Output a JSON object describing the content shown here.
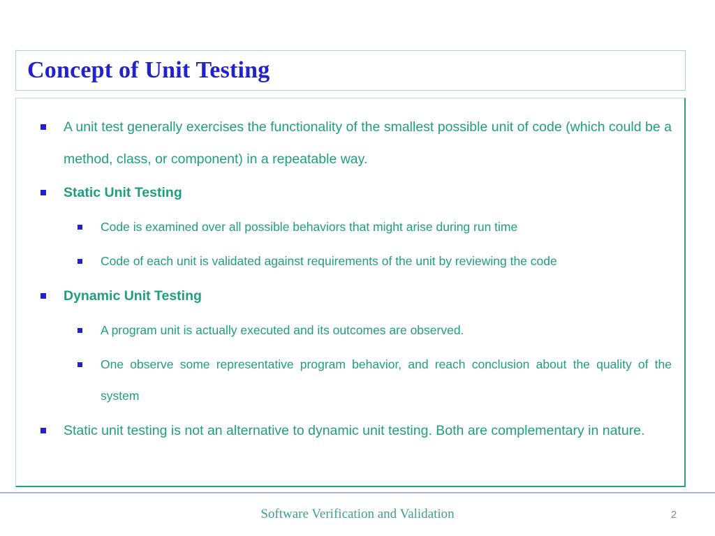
{
  "slide": {
    "title": "Concept of Unit Testing",
    "title_color": "#2222cc",
    "body_color": "#1f9e7e",
    "bullet_color": "#2222cc",
    "border_color": "#2f9e7e",
    "bullets": [
      {
        "level": 1,
        "bold": false,
        "justified": true,
        "text": "A unit test generally exercises the functionality of the smallest possible unit of code (which could be a method, class, or component) in a repeatable way."
      },
      {
        "level": 1,
        "bold": true,
        "justified": false,
        "text": "Static Unit Testing"
      },
      {
        "level": 2,
        "bold": false,
        "justified": false,
        "text": "Code is examined over all possible behaviors that might arise during run time"
      },
      {
        "level": 2,
        "bold": false,
        "justified": false,
        "text": "Code of each unit is validated against requirements of the unit by reviewing the code"
      },
      {
        "level": 1,
        "bold": true,
        "justified": false,
        "text": "Dynamic Unit Testing"
      },
      {
        "level": 2,
        "bold": false,
        "justified": false,
        "text": "A program unit is actually executed and its outcomes are observed."
      },
      {
        "level": 2,
        "bold": false,
        "justified": true,
        "text": "One observe some representative program behavior, and reach conclusion about the quality of the system"
      },
      {
        "level": 1,
        "bold": false,
        "justified": true,
        "text": "Static unit testing is not an alternative to dynamic unit testing. Both are complementary in nature."
      }
    ]
  },
  "footer": {
    "text": "Software Verification and Validation",
    "page_number": "2"
  }
}
